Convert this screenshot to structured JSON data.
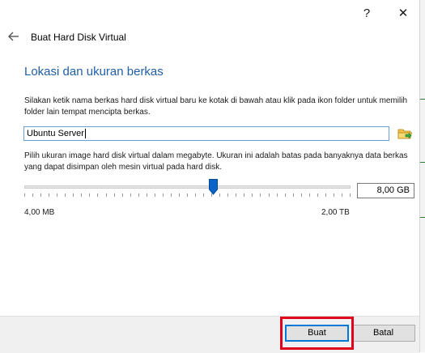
{
  "window": {
    "help_glyph": "?",
    "close_glyph": "✕",
    "title": "Buat Hard Disk Virtual"
  },
  "section": {
    "title": "Lokasi dan ukuran berkas"
  },
  "location": {
    "instructions": "Silakan ketik nama berkas hard disk virtual baru ke kotak di bawah atau klik pada ikon folder untuk memilih folder lain tempat mencipta berkas.",
    "file_name": "Ubuntu Server"
  },
  "size": {
    "instructions": "Pilih ukuran image hard disk virtual dalam megabyte. Ukuran ini adalah batas pada banyaknya data berkas yang dapat disimpan oleh mesin virtual pada hard disk.",
    "value": "8,00 GB",
    "min_label": "4,00 MB",
    "max_label": "2,00 TB",
    "slider_position_fraction": 0.58
  },
  "buttons": {
    "create": "Buat",
    "cancel": "Batal"
  },
  "colors": {
    "section_title": "#1f5fa8",
    "slider_thumb": "#0a64c8",
    "highlight": "#e0001b",
    "primary_border": "#0078d7"
  },
  "icons": {
    "back": "back-arrow-icon",
    "folder": "folder-icon"
  }
}
